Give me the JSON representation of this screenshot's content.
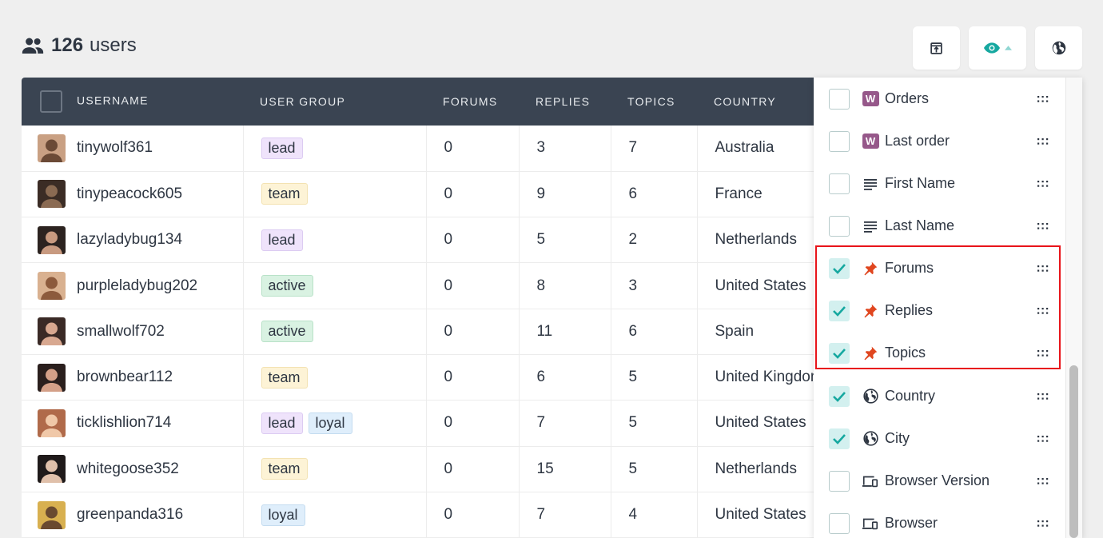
{
  "header": {
    "count": "126",
    "label": "users",
    "icon": "users-icon"
  },
  "toolbar": {
    "export_icon": "export-icon",
    "columns_icon": "eye-icon",
    "columns_caret": "caret-up-icon",
    "globe_icon": "globe-icon"
  },
  "table": {
    "columns": [
      "USERNAME",
      "USER GROUP",
      "FORUMS",
      "REPLIES",
      "TOPICS",
      "COUNTRY"
    ],
    "rows": [
      {
        "username": "tinywolf361",
        "groups": [
          "lead"
        ],
        "forums": "0",
        "replies": "3",
        "topics": "7",
        "country": "Australia"
      },
      {
        "username": "tinypeacock605",
        "groups": [
          "team"
        ],
        "forums": "0",
        "replies": "9",
        "topics": "6",
        "country": "France"
      },
      {
        "username": "lazyladybug134",
        "groups": [
          "lead"
        ],
        "forums": "0",
        "replies": "5",
        "topics": "2",
        "country": "Netherlands"
      },
      {
        "username": "purpleladybug202",
        "groups": [
          "active"
        ],
        "forums": "0",
        "replies": "8",
        "topics": "3",
        "country": "United States"
      },
      {
        "username": "smallwolf702",
        "groups": [
          "active"
        ],
        "forums": "0",
        "replies": "11",
        "topics": "6",
        "country": "Spain"
      },
      {
        "username": "brownbear112",
        "groups": [
          "team"
        ],
        "forums": "0",
        "replies": "6",
        "topics": "5",
        "country": "United Kingdom"
      },
      {
        "username": "ticklishlion714",
        "groups": [
          "lead",
          "loyal"
        ],
        "forums": "0",
        "replies": "7",
        "topics": "5",
        "country": "United States"
      },
      {
        "username": "whitegoose352",
        "groups": [
          "team"
        ],
        "forums": "0",
        "replies": "15",
        "topics": "5",
        "country": "Netherlands"
      },
      {
        "username": "greenpanda316",
        "groups": [
          "loyal"
        ],
        "forums": "0",
        "replies": "7",
        "topics": "4",
        "country": "United States"
      }
    ]
  },
  "column_menu": {
    "items": [
      {
        "label": "Orders",
        "checked": false,
        "icon": "woocommerce-icon"
      },
      {
        "label": "Last order",
        "checked": false,
        "icon": "woocommerce-icon"
      },
      {
        "label": "First Name",
        "checked": false,
        "icon": "text-lines-icon"
      },
      {
        "label": "Last Name",
        "checked": false,
        "icon": "text-lines-icon"
      },
      {
        "label": "Forums",
        "checked": true,
        "icon": "pin-icon"
      },
      {
        "label": "Replies",
        "checked": true,
        "icon": "pin-icon"
      },
      {
        "label": "Topics",
        "checked": true,
        "icon": "pin-icon"
      },
      {
        "label": "Country",
        "checked": true,
        "icon": "globe-icon"
      },
      {
        "label": "City",
        "checked": true,
        "icon": "globe-icon"
      },
      {
        "label": "Browser Version",
        "checked": false,
        "icon": "devices-icon"
      },
      {
        "label": "Browser",
        "checked": false,
        "icon": "devices-icon"
      }
    ]
  },
  "colors": {
    "header_bg": "#3a4452",
    "accent_teal": "#16a8a0",
    "pin_orange": "#e0461f",
    "woo_purple": "#96588a",
    "highlight_red": "#e8141a"
  }
}
